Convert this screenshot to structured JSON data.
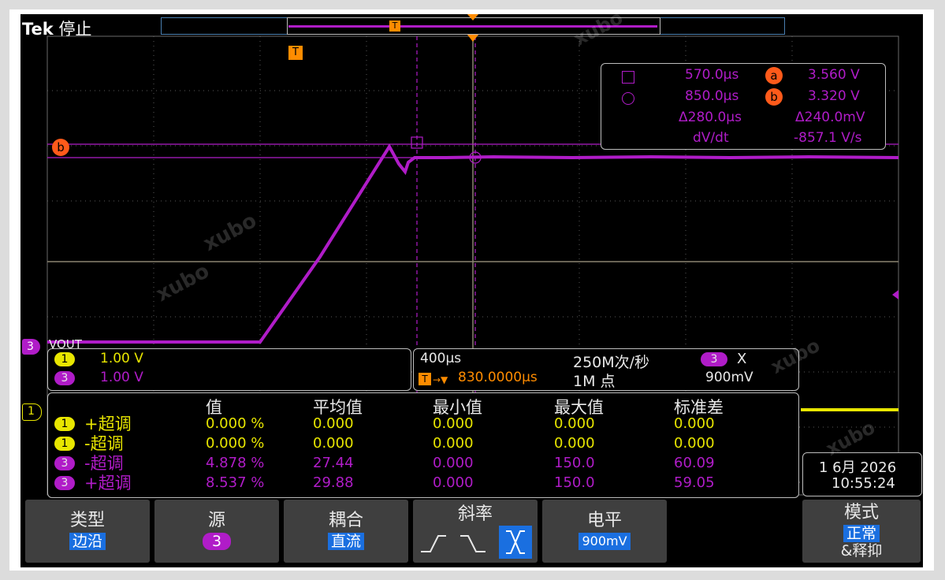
{
  "header": {
    "brand": "Tek",
    "state": "停止",
    "trigger_marker": "T"
  },
  "waveform": {
    "channel_label": "VOUT",
    "channel_number": "3",
    "cursor_a_label": "a",
    "cursor_b_label": "b",
    "trigger_marker": "T",
    "ch1_marker": "1",
    "trace_color": "#b01cc8",
    "ch1_color": "#e8e600"
  },
  "cursor_readout": {
    "row1_time": "570.0μs",
    "row1_tag": "a",
    "row1_volt": "3.560 V",
    "row2_time": "850.0μs",
    "row2_tag": "b",
    "row2_volt": "3.320 V",
    "delta_time": "Δ280.0μs",
    "delta_volt": "Δ240.0mV",
    "dvdt_label": "dV/dt",
    "dvdt_value": "-857.1 V/s"
  },
  "channel_scales": {
    "ch1_badge": "1",
    "ch1_scale": "1.00 V",
    "ch3_badge": "3",
    "ch3_scale": "1.00 V"
  },
  "acquisition": {
    "timebase": "400μs",
    "sample_rate": "250M次/秒",
    "trigger_source": "3",
    "trigger_slope_symbol": "X",
    "trigger_icon": "T",
    "trigger_position": "830.0000μs",
    "record_length": "1M 点",
    "trigger_level": "900mV"
  },
  "measurements": {
    "headers": [
      "值",
      "平均值",
      "最小值",
      "最大值",
      "标准差"
    ],
    "rows": [
      {
        "ch": "1",
        "name": "+超调",
        "value": "0.000 %",
        "mean": "0.000",
        "min": "0.000",
        "max": "0.000",
        "std": "0.000"
      },
      {
        "ch": "1",
        "name": "-超调",
        "value": "0.000 %",
        "mean": "0.000",
        "min": "0.000",
        "max": "0.000",
        "std": "0.000"
      },
      {
        "ch": "3",
        "name": "-超调",
        "value": "4.878 %",
        "mean": "27.44",
        "min": "0.000",
        "max": "150.0",
        "std": "60.09"
      },
      {
        "ch": "3",
        "name": "+超调",
        "value": "8.537 %",
        "mean": "29.88",
        "min": "0.000",
        "max": "150.0",
        "std": "59.05"
      }
    ]
  },
  "datetime": {
    "date": "1 6月 2026",
    "time": "10:55:24"
  },
  "softkeys": {
    "type_title": "类型",
    "type_value": "边沿",
    "source_title": "源",
    "source_value": "3",
    "coupling_title": "耦合",
    "coupling_value": "直流",
    "slope_title": "斜率",
    "level_title": "电平",
    "level_value": "900mV",
    "mode_title": "模式",
    "mode_value": "正常",
    "mode_sub": "&释抑"
  },
  "watermark": "xubo"
}
